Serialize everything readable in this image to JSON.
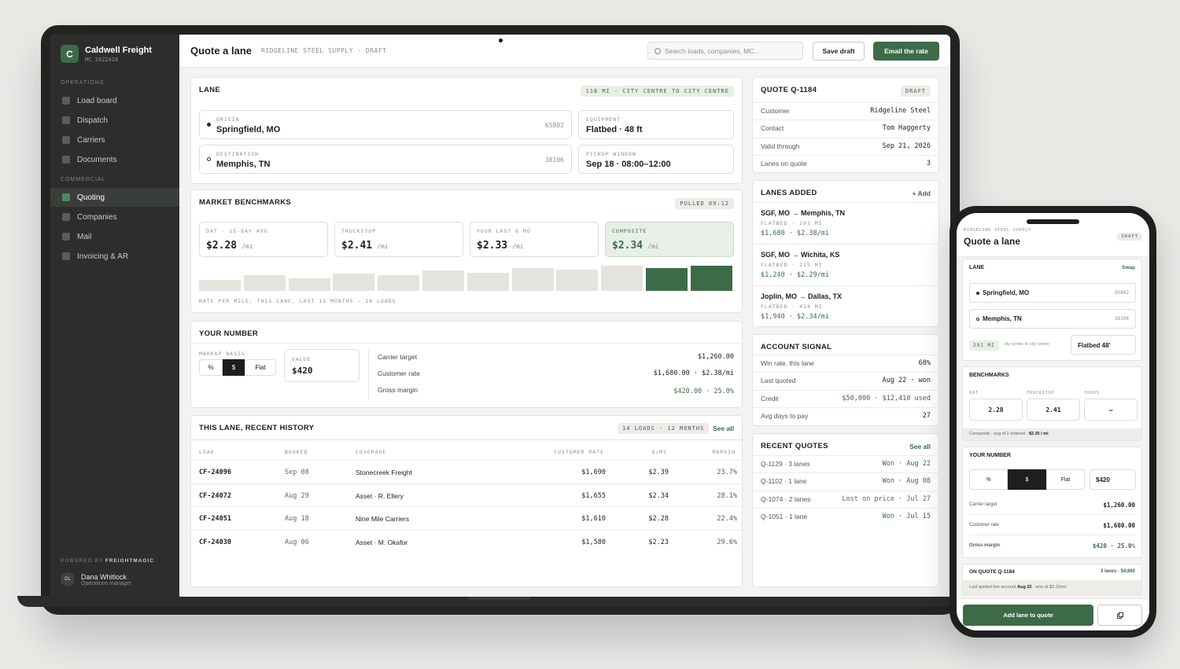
{
  "brand": {
    "name": "Caldwell Freight",
    "mc": "MC 1622418",
    "logo": "C"
  },
  "sidebar": {
    "operations_label": "OPERATIONS",
    "commercial_label": "COMMERCIAL",
    "ops_items": [
      "Load board",
      "Dispatch",
      "Carriers",
      "Documents"
    ],
    "com_items": [
      "Quoting",
      "Companies",
      "Mail",
      "Invoicing & AR"
    ],
    "active": "Quoting",
    "powered_prefix": "POWERED BY ",
    "powered_brand": "FREIGHTMAGIC",
    "user": {
      "initials": "DL",
      "name": "Dana Whitlock",
      "role": "Operations manager"
    }
  },
  "topbar": {
    "title": "Quote a lane",
    "crumb": "RIDGELINE STEEL SUPPLY · DRAFT",
    "search_placeholder": "Search loads, companies, MC...",
    "save_label": "Save draft",
    "email_label": "Email the rate"
  },
  "lane": {
    "title": "LANE",
    "pill": "118 MI · CITY CENTRE TO CITY CENTRE",
    "origin_label": "ORIGIN",
    "origin": "Springfield, MO",
    "origin_zip": "65802",
    "dest_label": "DESTINATION",
    "dest": "Memphis, TN",
    "dest_zip": "38106",
    "equip_label": "EQUIPMENT",
    "equip": "Flatbed · 48 ft",
    "pickup_label": "PICKUP WINDOW",
    "pickup": "Sep 18 · 08:00–12:00"
  },
  "bench": {
    "title": "MARKET BENCHMARKS",
    "pill": "PULLED 09:12",
    "items": [
      {
        "label": "DAT · 15-DAY AVG",
        "value": "$2.28",
        "unit": "/mi"
      },
      {
        "label": "TRUCKSTOP",
        "value": "$2.41",
        "unit": "/mi"
      },
      {
        "label": "YOUR LAST 6 MO",
        "value": "$2.33",
        "unit": "/mi"
      },
      {
        "label": "COMPOSITE",
        "value": "$2.34",
        "unit": "/mi"
      }
    ],
    "caption": "RATE PER MILE, THIS LANE, LAST 12 MONTHS — 14 LOADS",
    "bars": [
      0.45,
      0.62,
      0.5,
      0.7,
      0.64,
      0.8,
      0.72,
      0.9,
      0.84,
      1.0,
      0.92,
      1.0
    ],
    "highlight_from": 10
  },
  "yournum": {
    "title": "YOUR NUMBER",
    "markup_label": "MARKUP BASIS",
    "seg": [
      "%",
      "$",
      "Flat"
    ],
    "value_label": "VALUE",
    "value": "$420",
    "rows": [
      {
        "k": "Carrier target",
        "v": "$1,260.00"
      },
      {
        "k": "Customer rate",
        "v": "$1,680.00 · $2.38/mi"
      },
      {
        "k": "Gross margin",
        "v": "$420.00 · 25.0%"
      }
    ]
  },
  "history": {
    "title": "THIS LANE, RECENT HISTORY",
    "pill": "14 LOADS · 12 MONTHS",
    "see_all": "See all",
    "headers": [
      "LOAD",
      "BOOKED",
      "COVERAGE",
      "CUSTOMER RATE",
      "$/MI",
      "MARGIN"
    ],
    "rows": [
      [
        "CF-24096",
        "Sep 08",
        "Stonecreek Freight",
        "$1,690",
        "$2.39",
        "23.7%"
      ],
      [
        "CF-24072",
        "Aug 29",
        "Asset · R. Ellery",
        "$1,655",
        "$2.34",
        "28.1%"
      ],
      [
        "CF-24051",
        "Aug 18",
        "Nine Mile Carriers",
        "$1,610",
        "$2.28",
        "22.4%"
      ],
      [
        "CF-24030",
        "Aug 06",
        "Asset · M. Okafor",
        "$1,580",
        "$2.23",
        "29.6%"
      ]
    ]
  },
  "quote": {
    "title": "QUOTE Q-1184",
    "badge": "DRAFT",
    "rows": [
      {
        "k": "Customer",
        "v": "Ridgeline Steel"
      },
      {
        "k": "Contact",
        "v": "Tom Haggerty"
      },
      {
        "k": "Valid through",
        "v": "Sep 21, 2026"
      },
      {
        "k": "Lanes on quote",
        "v": "3"
      }
    ]
  },
  "lanes_added": {
    "title": "LANES ADDED",
    "add": "+ Add",
    "items": [
      {
        "route": "SGF, MO → Memphis, TN",
        "meta": "FLATBED · 291 MI",
        "price": "$1,680 · $2.38/mi"
      },
      {
        "route": "SGF, MO → Wichita, KS",
        "meta": "FLATBED · 225 MI",
        "price": "$1,240 · $2.29/mi"
      },
      {
        "route": "Joplin, MO → Dallas, TX",
        "meta": "FLATBED · 414 MI",
        "price": "$1,940 · $2.34/mi"
      }
    ]
  },
  "signal": {
    "title": "ACCOUNT SIGNAL",
    "rows": [
      {
        "k": "Win rate, this lane",
        "v": "68%"
      },
      {
        "k": "Last quoted",
        "v": "Aug 22 · won"
      },
      {
        "k": "Credit",
        "v": "$50,000 · $12,410 used"
      },
      {
        "k": "Avg days to pay",
        "v": "27"
      }
    ]
  },
  "recent": {
    "title": "RECENT QUOTES",
    "see_all": "See all",
    "rows": [
      {
        "k": "Q-1129 · 3 lanes",
        "v": "Won · Aug 22"
      },
      {
        "k": "Q-1102 · 1 lane",
        "v": "Won · Aug 08"
      },
      {
        "k": "Q-1074 · 2 lanes",
        "v": "Lost on price · Jul 27"
      },
      {
        "k": "Q-1051 · 1 lane",
        "v": "Won · Jul 15"
      }
    ]
  },
  "phone": {
    "crumb": "RIDGELINE STEEL SUPPLY",
    "title": "Quote a lane",
    "badge": "DRAFT",
    "lane_title": "LANE",
    "swap": "Swap",
    "origin": "Springfield, MO",
    "origin_zip": "65802",
    "dest": "Memphis, TN",
    "dest_zip": "38106",
    "mi": "291 MI",
    "mi_note": "city centre to city centre",
    "equip": "Flatbed 48'",
    "bench_title": "BENCHMARKS",
    "bench_labels": [
      "DAT",
      "TRUCKSTOP",
      "YOURS"
    ],
    "bench_vals": [
      "2.28",
      "2.41",
      "–"
    ],
    "composite_prefix": "Composite · avg of 2 entered · ",
    "composite_val": "$2.35 / mi",
    "yn_title": "YOUR NUMBER",
    "seg": [
      "%",
      "$",
      "Flat"
    ],
    "value": "$420",
    "rows": [
      {
        "k": "Carrier target",
        "v": "$1,260.00"
      },
      {
        "k": "Customer rate",
        "v": "$1,680.00"
      },
      {
        "k": "Gross margin",
        "v": "$420 · 25.0%"
      }
    ],
    "onquote_title": "ON QUOTE Q-1184",
    "onquote_meta": "3 lanes · $4,860",
    "last_prefix": "Last quoted this account ",
    "last_date": "Aug 22",
    "last_suffix": " · won at $2.31/mi",
    "add_btn": "Add lane to quote",
    "copy_icon": "copy-icon"
  },
  "colors": {
    "accent": "#3d6b48",
    "sidebar": "#2b2e2b"
  }
}
